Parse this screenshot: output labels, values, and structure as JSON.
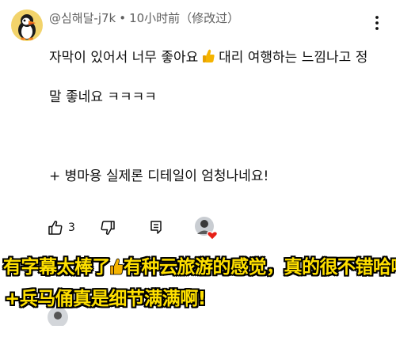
{
  "comment": {
    "author": "@심해달-j7k",
    "separator": "•",
    "time": "10小时前（修改过）",
    "lines": [
      "자막이 있어서 너무 좋아요",
      "대리 여행하는 느낌나고 정",
      "말 좋네요 ㅋㅋㅋㅋ",
      "+ 병마용 실제론 디테일이 엄청나네요!"
    ],
    "like_count": "3"
  },
  "subtitle": {
    "line1_a": "有字幕太棒了",
    "line1_b": "有种云旅游的感觉，真的很不错哈哈",
    "line2": "+兵马俑真是细节满满啊!"
  },
  "icons": {
    "menu": "more-vert-icon",
    "like": "thumb-up-icon",
    "dislike": "thumb-down-icon",
    "reply": "reply-icon",
    "emoji": "thumbs-up-emoji",
    "creator_heart": "heart-icon"
  },
  "colors": {
    "meta_text": "#606060",
    "body_text": "#0f0f0f",
    "subtitle_fill": "#ffe000",
    "subtitle_outline": "#000000",
    "heart": "#e62117",
    "emoji": "#f5b400"
  }
}
